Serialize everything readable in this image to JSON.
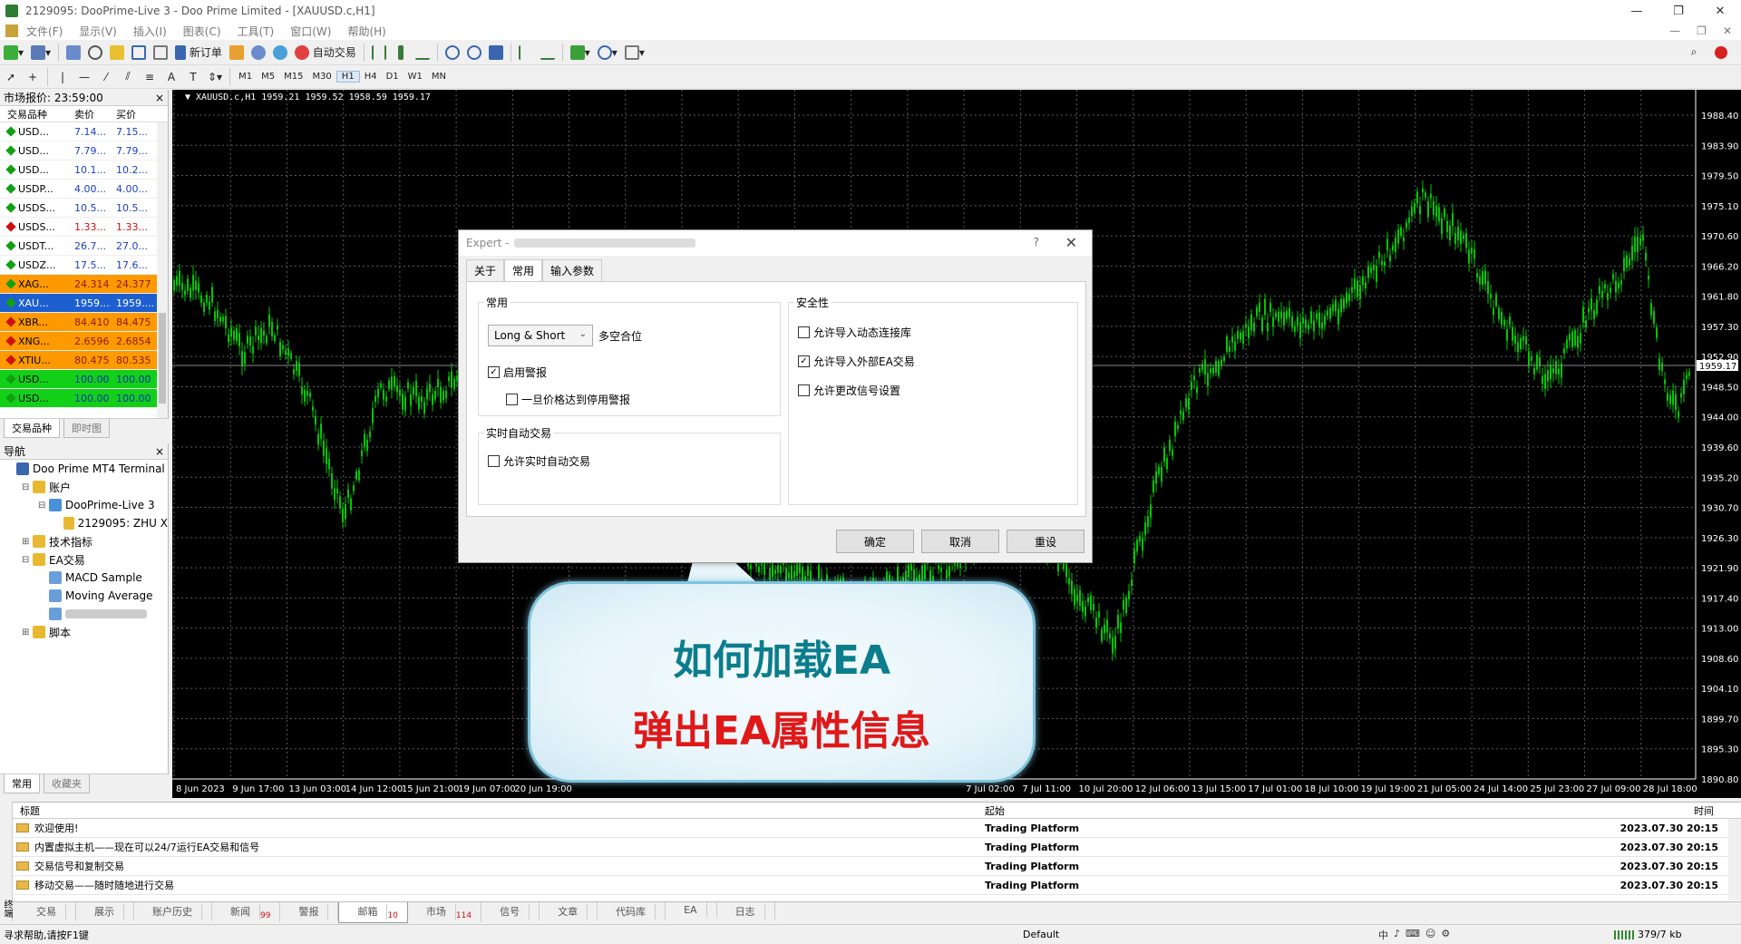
{
  "window": {
    "title": "2129095: DooPrime-Live 3 - Doo Prime Limited - [XAUUSD.c,H1]",
    "minimize": "—",
    "restore": "❐",
    "close": "✕"
  },
  "menu": {
    "items": [
      "文件(F)",
      "显示(V)",
      "插入(I)",
      "图表(C)",
      "工具(T)",
      "窗口(W)",
      "帮助(H)"
    ],
    "right": [
      "—",
      "❐",
      "✕"
    ]
  },
  "toolbar": {
    "new_order": "新订单",
    "auto_trade": "自动交易",
    "timeframes": [
      "M1",
      "M5",
      "M15",
      "M30",
      "H1",
      "H4",
      "D1",
      "W1",
      "MN"
    ],
    "active_timeframe": "H1",
    "text_tool": "A",
    "label_tool": "T"
  },
  "market_watch": {
    "title": "市场报价: 23:59:00",
    "close": "×",
    "columns": [
      "交易品种",
      "卖价",
      "买价"
    ],
    "rows": [
      {
        "symbol": "USD...",
        "bid": "7.14...",
        "ask": "7.15...",
        "style": "normal",
        "dir": "up"
      },
      {
        "symbol": "USD...",
        "bid": "7.79...",
        "ask": "7.79...",
        "style": "normal",
        "dir": "up"
      },
      {
        "symbol": "USD...",
        "bid": "10.1...",
        "ask": "10.2...",
        "style": "normal",
        "dir": "up"
      },
      {
        "symbol": "USDP...",
        "bid": "4.00...",
        "ask": "4.00...",
        "style": "normal",
        "dir": "up"
      },
      {
        "symbol": "USDS...",
        "bid": "10.5...",
        "ask": "10.5...",
        "style": "normal",
        "dir": "up"
      },
      {
        "symbol": "USDS...",
        "bid": "1.33...",
        "ask": "1.33...",
        "style": "red",
        "dir": "down"
      },
      {
        "symbol": "USDT...",
        "bid": "26.7...",
        "ask": "27.0...",
        "style": "normal",
        "dir": "up"
      },
      {
        "symbol": "USDZ...",
        "bid": "17.5...",
        "ask": "17.6...",
        "style": "normal",
        "dir": "up"
      },
      {
        "symbol": "XAG...",
        "bid": "24.314",
        "ask": "24.377",
        "style": "orange",
        "dir": "up"
      },
      {
        "symbol": "XAU...",
        "bid": "1959....",
        "ask": "1959....",
        "style": "selected",
        "dir": "up"
      },
      {
        "symbol": "XBR...",
        "bid": "84.410",
        "ask": "84.475",
        "style": "orange",
        "dir": "down"
      },
      {
        "symbol": "XNG...",
        "bid": "2.6596",
        "ask": "2.6854",
        "style": "orange",
        "dir": "down"
      },
      {
        "symbol": "XTIU...",
        "bid": "80.475",
        "ask": "80.535",
        "style": "orange",
        "dir": "down"
      },
      {
        "symbol": "USD...",
        "bid": "100.00",
        "ask": "100.00",
        "style": "green",
        "dir": "up"
      },
      {
        "symbol": "USD...",
        "bid": "100.00",
        "ask": "100.00",
        "style": "green",
        "dir": "up"
      }
    ],
    "tabs": [
      "交易品种",
      "即时图"
    ]
  },
  "navigator": {
    "title": "导航",
    "close": "×",
    "items": [
      {
        "label": "Doo Prime MT4 Terminal",
        "level": 0,
        "icon": "terminal-icon"
      },
      {
        "label": "账户",
        "level": 1,
        "icon": "accounts-icon",
        "toggle": "⊟"
      },
      {
        "label": "DooPrime-Live 3",
        "level": 2,
        "icon": "server-icon",
        "toggle": "⊟"
      },
      {
        "label": "2129095: ZHU X",
        "level": 3,
        "icon": "user-icon"
      },
      {
        "label": "技术指标",
        "level": 1,
        "icon": "indicators-icon",
        "toggle": "⊞"
      },
      {
        "label": "EA交易",
        "level": 1,
        "icon": "expert-advisors-icon",
        "toggle": "⊟"
      },
      {
        "label": "MACD Sample",
        "level": 2,
        "icon": "ea-icon"
      },
      {
        "label": "Moving Average",
        "level": 2,
        "icon": "ea-icon"
      },
      {
        "label": "",
        "level": 2,
        "icon": "ea-icon"
      },
      {
        "label": "脚本",
        "level": 1,
        "icon": "scripts-icon",
        "toggle": "⊞"
      }
    ],
    "tabs": [
      "常用",
      "收藏夹"
    ]
  },
  "chart": {
    "info": "▼ XAUUSD.c,H1  1959.21 1959.52 1958.59 1959.17",
    "current_price": "1959.17",
    "price_labels": [
      "1988.40",
      "1983.90",
      "1979.50",
      "1975.10",
      "1970.60",
      "1966.20",
      "1961.80",
      "1957.30",
      "1952.90",
      "1948.50",
      "1944.00",
      "1939.60",
      "1935.20",
      "1930.70",
      "1926.30",
      "1921.90",
      "1917.40",
      "1913.00",
      "1908.60",
      "1904.10",
      "1899.70",
      "1895.30",
      "1890.80"
    ],
    "time_labels": [
      "8 Jun 2023",
      "9 Jun 17:00",
      "13 Jun 03:00",
      "14 Jun 12:00",
      "15 Jun 21:00",
      "19 Jun 07:00",
      "20 Jun 19:00",
      "",
      "",
      "",
      "",
      "",
      "",
      "",
      "7 Jul 02:00",
      "7 Jul 11:00",
      "10 Jul 20:00",
      "12 Jul 06:00",
      "13 Jul 15:00",
      "17 Jul 01:00",
      "18 Jul 10:00",
      "19 Jul 19:00",
      "21 Jul 05:00",
      "24 Jul 14:00",
      "25 Jul 23:00",
      "27 Jul 09:00",
      "28 Jul 18:00"
    ],
    "candle_color": "#00c800",
    "grid_color": "#5a5a5a"
  },
  "dialog": {
    "title": "Expert -",
    "help": "?",
    "close": "✕",
    "tabs": [
      "关于",
      "常用",
      "输入参数"
    ],
    "active_tab": "常用",
    "common_group": "常用",
    "position_select": "Long & Short",
    "position_label": "多空合位",
    "enable_alerts": "启用警报",
    "enable_alerts_checked": true,
    "disable_on_price": "一旦价格达到停用警报",
    "disable_on_price_checked": false,
    "live_group": "实时自动交易",
    "allow_live": "允许实时自动交易",
    "allow_live_checked": false,
    "safety_group": "安全性",
    "allow_dll": "允许导入动态连接库",
    "allow_dll_checked": false,
    "allow_external": "允许导入外部EA交易",
    "allow_external_checked": true,
    "allow_signal": "允许更改信号设置",
    "allow_signal_checked": false,
    "ok": "确定",
    "cancel": "取消",
    "reset": "重设"
  },
  "callout": {
    "line1": "如何加载EA",
    "line2": "弹出EA属性信息",
    "line1_color": "#0b7d8c",
    "line2_color": "#e01818"
  },
  "terminal": {
    "side_label": "终端",
    "columns": {
      "subject": "标题",
      "from": "起始",
      "time": "时间"
    },
    "rows": [
      {
        "subject": "欢迎使用!",
        "from": "Trading Platform",
        "time": "2023.07.30 20:15"
      },
      {
        "subject": "内置虚拟主机——现在可以24/7运行EA交易和信号",
        "from": "Trading Platform",
        "time": "2023.07.30 20:15"
      },
      {
        "subject": "交易信号和复制交易",
        "from": "Trading Platform",
        "time": "2023.07.30 20:15"
      },
      {
        "subject": "移动交易——随时随地进行交易",
        "from": "Trading Platform",
        "time": "2023.07.30 20:15"
      }
    ],
    "tabs": [
      {
        "label": "交易",
        "badge": ""
      },
      {
        "label": "展示",
        "badge": ""
      },
      {
        "label": "账户历史",
        "badge": ""
      },
      {
        "label": "新闻",
        "badge": "99"
      },
      {
        "label": "警报",
        "badge": ""
      },
      {
        "label": "邮箱",
        "badge": "10",
        "active": true
      },
      {
        "label": "市场",
        "badge": "114"
      },
      {
        "label": "信号",
        "badge": ""
      },
      {
        "label": "文章",
        "badge": ""
      },
      {
        "label": "代码库",
        "badge": ""
      },
      {
        "label": "EA",
        "badge": ""
      },
      {
        "label": "日志",
        "badge": ""
      }
    ]
  },
  "status": {
    "help": "寻求帮助,请按F1键",
    "profile": "Default",
    "ime": [
      "中",
      "♪",
      "⌨",
      "☺",
      "⚙"
    ],
    "connection": "379/7 kb"
  }
}
